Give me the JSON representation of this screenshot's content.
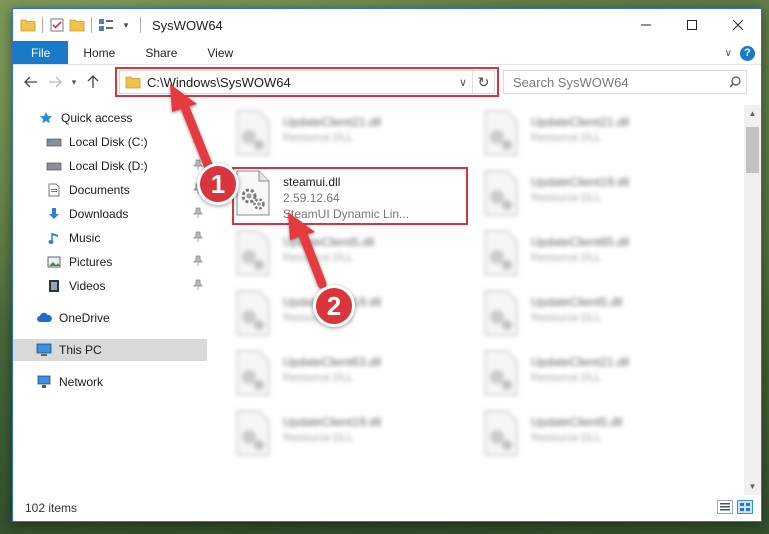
{
  "window": {
    "title": "SysWOW64"
  },
  "ribbon": {
    "tabs": [
      {
        "label": "File"
      },
      {
        "label": "Home"
      },
      {
        "label": "Share"
      },
      {
        "label": "View"
      }
    ]
  },
  "address": {
    "path": "C:\\Windows\\SysWOW64"
  },
  "search": {
    "placeholder": "Search SysWOW64"
  },
  "sidebar": {
    "items": [
      {
        "label": "Quick access",
        "icon": "star-icon"
      },
      {
        "label": "Local Disk (C:)",
        "icon": "drive-icon"
      },
      {
        "label": "Local Disk (D:)",
        "icon": "drive-icon"
      },
      {
        "label": "Documents",
        "icon": "documents-icon"
      },
      {
        "label": "Downloads",
        "icon": "download-icon"
      },
      {
        "label": "Music",
        "icon": "music-icon"
      },
      {
        "label": "Pictures",
        "icon": "pictures-icon"
      },
      {
        "label": "Videos",
        "icon": "videos-icon"
      },
      {
        "label": "OneDrive",
        "icon": "cloud-icon"
      },
      {
        "label": "This PC",
        "icon": "computer-icon"
      },
      {
        "label": "Network",
        "icon": "network-icon"
      }
    ]
  },
  "files": {
    "left": [
      {
        "name": "UpdateClient21.dll",
        "desc": "Resource DLL"
      },
      {
        "name": "steamui.dll",
        "version": "2.59.12.64",
        "desc": "SteamUI Dynamic Lin..."
      },
      {
        "name": "UpdateClient5.dll",
        "desc": "Resource DLL"
      },
      {
        "name": "UpdateClient19.dll",
        "desc": "Resource DLL"
      },
      {
        "name": "UpdateClient63.dll",
        "desc": "Resource DLL"
      },
      {
        "name": "UpdateClient19.dll",
        "desc": "Resource DLL"
      }
    ],
    "right": [
      {
        "name": "UpdateClient21.dll",
        "desc": "Resource DLL"
      },
      {
        "name": "UpdateClient19.dll",
        "desc": "Resource DLL"
      },
      {
        "name": "UpdateClient65.dll",
        "desc": "Resource DLL"
      },
      {
        "name": "UpdateClient5.dll",
        "desc": "Resource DLL"
      },
      {
        "name": "UpdateClient21.dll",
        "desc": "Resource DLL"
      },
      {
        "name": "UpdateClient5.dll",
        "desc": "Resource DLL"
      }
    ]
  },
  "callouts": [
    {
      "number": "1"
    },
    {
      "number": "2"
    }
  ],
  "status": {
    "item_count": "102 items"
  },
  "colors": {
    "accent": "#1979ca",
    "highlight": "#d9353c"
  }
}
